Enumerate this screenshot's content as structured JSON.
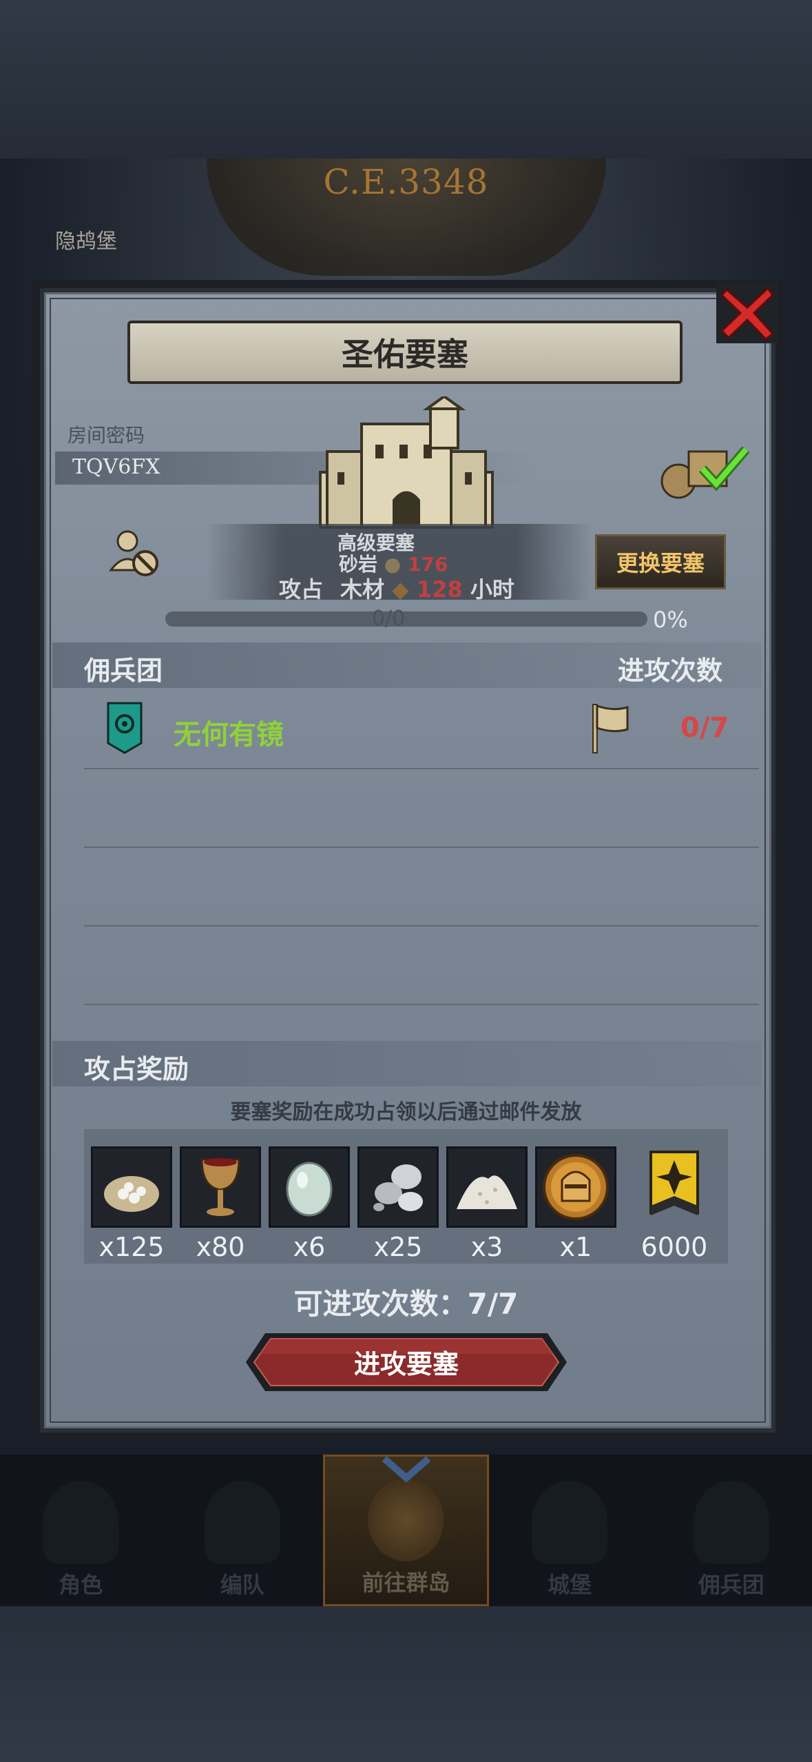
{
  "background": {
    "era_text": "C.E.3348",
    "map_label": "隐鸪堡"
  },
  "dialog": {
    "title": "圣佑要塞",
    "room_label": "房间密码",
    "room_code": "TQV6FX",
    "fortress_info": {
      "line1": "高级要塞",
      "line2_label": "砂岩",
      "line2_value": "176",
      "line3_prefix": "攻占",
      "line3_label": "木材",
      "line3_value": "128",
      "line3_suffix": "小时"
    },
    "change_button": "更换要塞",
    "progress": {
      "value_text": "0/0",
      "percent_text": "0%",
      "fraction": 0
    },
    "mercenary": {
      "header": "佣兵团",
      "attack_header": "进攻次数",
      "rows": [
        {
          "name": "无何有镜",
          "count": "0/7"
        }
      ]
    },
    "rewards": {
      "header": "攻占奖励",
      "note": "要塞奖励在成功占领以后通过邮件发放",
      "items": [
        {
          "icon": "salt-sack-icon",
          "qty": "x125"
        },
        {
          "icon": "goblet-icon",
          "qty": "x80"
        },
        {
          "icon": "pearl-stone-icon",
          "qty": "x6"
        },
        {
          "icon": "silver-ore-icon",
          "qty": "x25"
        },
        {
          "icon": "sand-pile-icon",
          "qty": "x3"
        },
        {
          "icon": "knight-helmet-medal-icon",
          "qty": "x1"
        },
        {
          "icon": "banner-emblem-icon",
          "qty": "6000"
        }
      ]
    },
    "remaining_attacks": "可进攻次数：7/7",
    "attack_button": "进攻要塞"
  },
  "bottom_nav": [
    {
      "label": "角色",
      "icon": "knight-icon",
      "active": false
    },
    {
      "label": "编队",
      "icon": "helmet-icon",
      "active": false
    },
    {
      "label": "前往群岛",
      "icon": "compass-map-icon",
      "active": true
    },
    {
      "label": "城堡",
      "icon": "castle-icon",
      "active": false
    },
    {
      "label": "佣兵团",
      "icon": "mercenary-icon",
      "active": false
    }
  ],
  "colors": {
    "guild_name": "#8fd13a",
    "attack_count": "#d64747",
    "change_button_text": "#f2c56a",
    "attack_button": "#8a2a2a"
  }
}
